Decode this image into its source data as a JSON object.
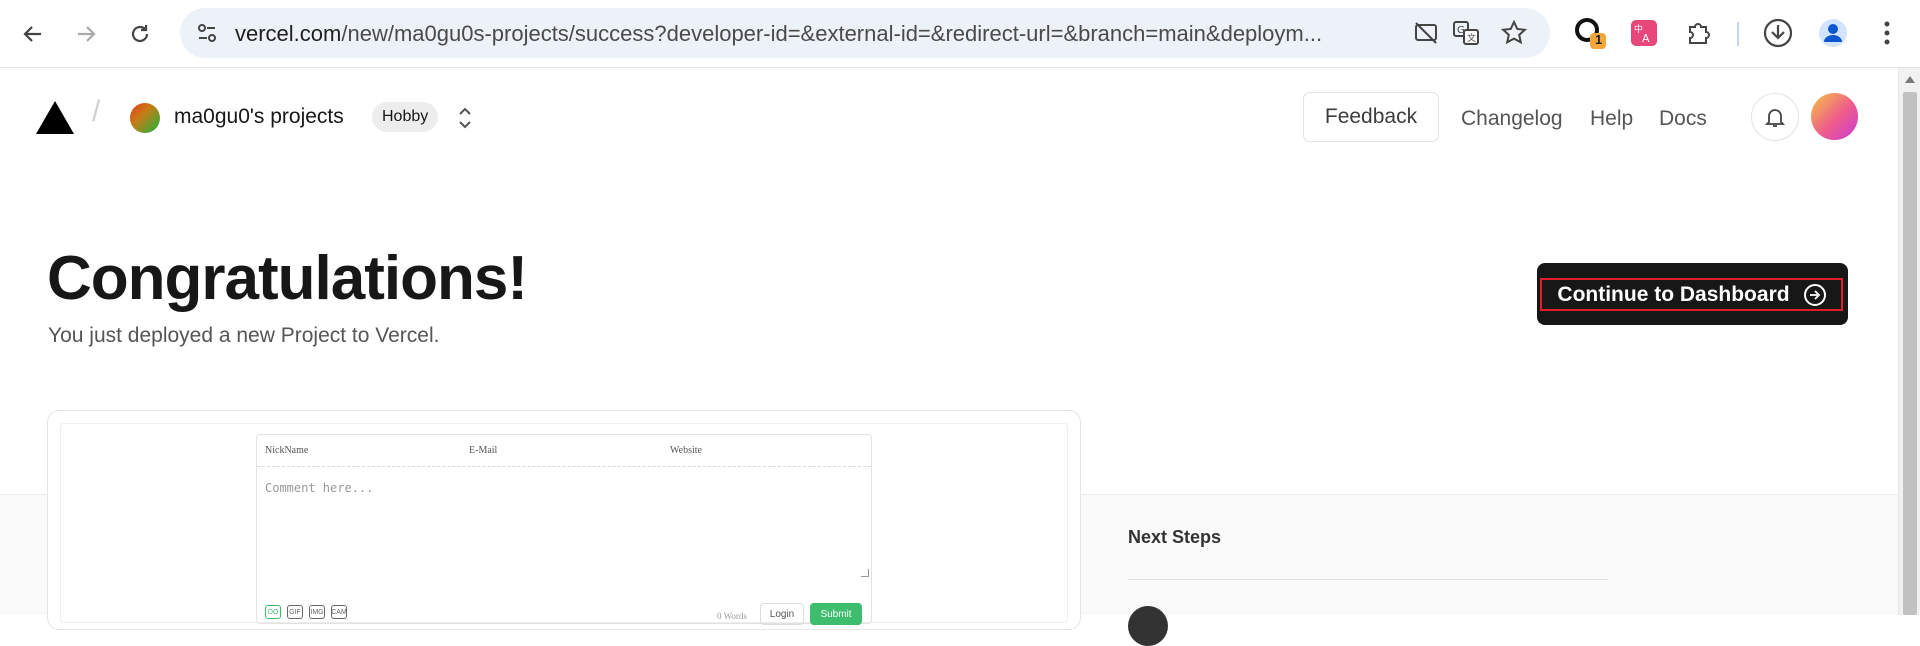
{
  "browser": {
    "url_host": "vercel.com",
    "url_rest": "/new/ma0gu0s-projects/success?developer-id=&external-id=&redirect-url=&branch=main&deploym...",
    "extension_badge": "1"
  },
  "header": {
    "team_name": "ma0gu0's projects",
    "plan_badge": "Hobby",
    "feedback_label": "Feedback",
    "links": [
      "Changelog",
      "Help",
      "Docs"
    ]
  },
  "main": {
    "title": "Congratulations!",
    "subtitle": "You just deployed a new Project to Vercel.",
    "cta_label": "Continue to Dashboard"
  },
  "preview": {
    "fields": [
      "NickName",
      "E-Mail",
      "Website"
    ],
    "placeholder": "Comment here...",
    "tools": [
      "OO",
      "GIF",
      "IMG",
      "CAM"
    ],
    "words": "0  Words",
    "login_label": "Login",
    "submit_label": "Submit"
  },
  "next_steps": {
    "title": "Next Steps"
  },
  "colors": {
    "cta_bg": "#171717",
    "cta_highlight": "#e11d2a",
    "submit_green": "#3dbd6d"
  }
}
